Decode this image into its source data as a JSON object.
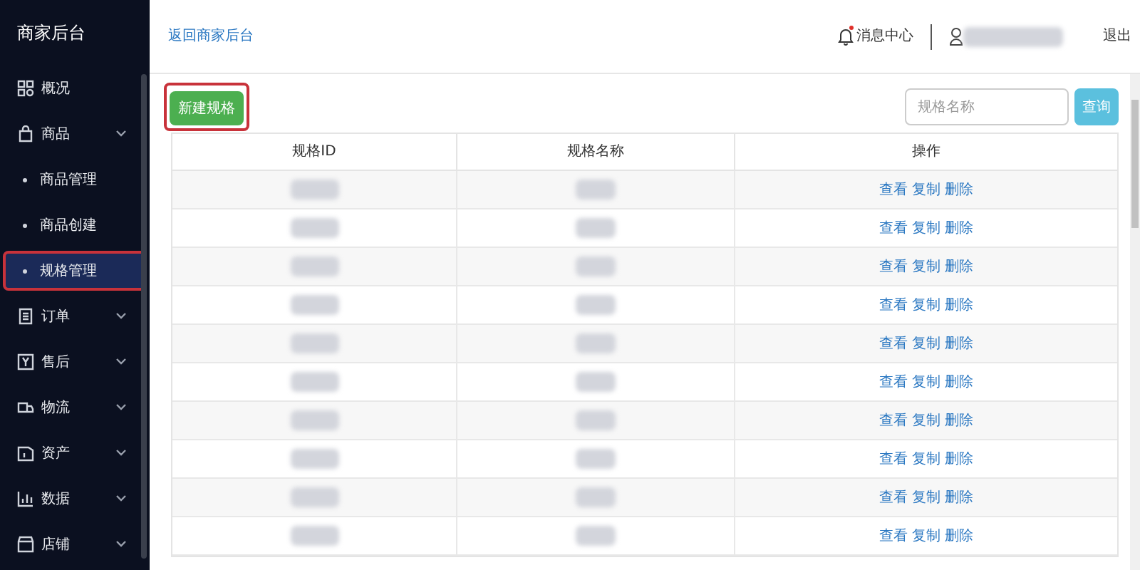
{
  "sidebar": {
    "title": "商家后台",
    "items": [
      {
        "kind": "group",
        "label": "概况",
        "selected": false,
        "highlighted": false,
        "chevron": false
      },
      {
        "kind": "group",
        "label": "商品",
        "selected": false,
        "highlighted": false,
        "chevron": true
      },
      {
        "kind": "sub",
        "label": "商品管理",
        "selected": false,
        "highlighted": false
      },
      {
        "kind": "sub",
        "label": "商品创建",
        "selected": false,
        "highlighted": false
      },
      {
        "kind": "sub",
        "label": "规格管理",
        "selected": true,
        "highlighted": true
      },
      {
        "kind": "group",
        "label": "订单",
        "selected": false,
        "highlighted": false,
        "chevron": true
      },
      {
        "kind": "group",
        "label": "售后",
        "selected": false,
        "highlighted": false,
        "chevron": true
      },
      {
        "kind": "group",
        "label": "物流",
        "selected": false,
        "highlighted": false,
        "chevron": true
      },
      {
        "kind": "group",
        "label": "资产",
        "selected": false,
        "highlighted": false,
        "chevron": true
      },
      {
        "kind": "group",
        "label": "数据",
        "selected": false,
        "highlighted": false,
        "chevron": true
      },
      {
        "kind": "group",
        "label": "店铺",
        "selected": false,
        "highlighted": false,
        "chevron": true
      }
    ]
  },
  "header": {
    "back_link": "返回商家后台",
    "messages": "消息中心",
    "has_unread": true,
    "logout": "退出"
  },
  "toolbar": {
    "new_button": "新建规格",
    "new_button_highlighted": true,
    "search": {
      "placeholder": "规格名称"
    },
    "search_button": "查询"
  },
  "table": {
    "columns": [
      "规格ID",
      "规格名称",
      "操作"
    ],
    "rows": [
      {
        "actions": [
          "查看",
          "复制",
          "删除"
        ]
      },
      {
        "actions": [
          "查看",
          "复制",
          "删除"
        ]
      },
      {
        "actions": [
          "查看",
          "复制",
          "删除"
        ]
      },
      {
        "actions": [
          "查看",
          "复制",
          "删除"
        ]
      },
      {
        "actions": [
          "查看",
          "复制",
          "删除"
        ]
      },
      {
        "actions": [
          "查看",
          "复制",
          "删除"
        ]
      },
      {
        "actions": [
          "查看",
          "复制",
          "删除"
        ]
      },
      {
        "actions": [
          "查看",
          "复制",
          "删除"
        ]
      },
      {
        "actions": [
          "查看",
          "复制",
          "删除"
        ]
      },
      {
        "actions": [
          "查看",
          "复制",
          "删除"
        ]
      }
    ]
  }
}
